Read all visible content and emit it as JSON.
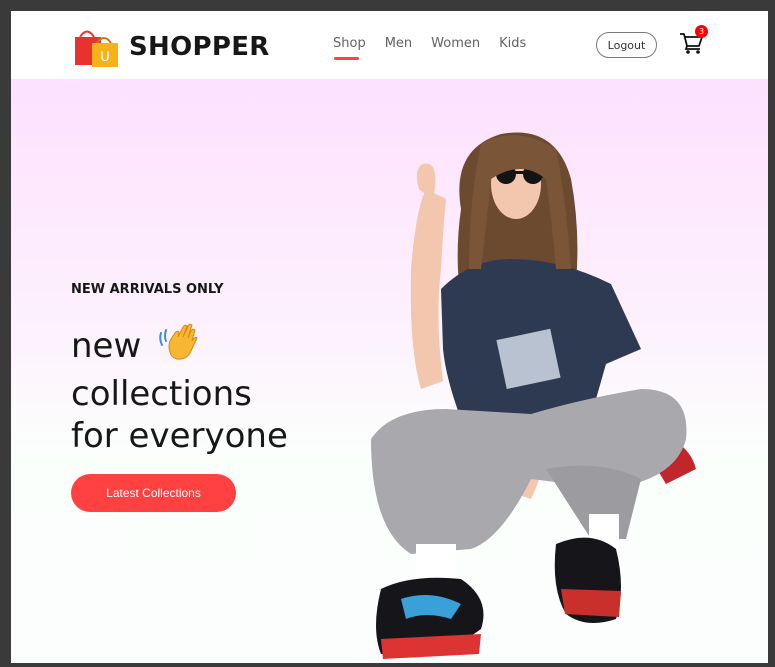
{
  "brand": {
    "name": "SHOPPER",
    "logo_letter": "U",
    "icon": "shopping-bag-logo"
  },
  "nav": {
    "items": [
      {
        "label": "Shop",
        "active": true
      },
      {
        "label": "Men",
        "active": false
      },
      {
        "label": "Women",
        "active": false
      },
      {
        "label": "Kids",
        "active": false
      }
    ],
    "logout_label": "Logout",
    "cart": {
      "icon": "cart-icon",
      "count": "3"
    }
  },
  "hero": {
    "eyebrow": "NEW ARRIVALS ONLY",
    "headline_line1": "new",
    "headline_line2": "collections",
    "headline_line3": "for everyone",
    "hand_icon": "waving-hand-icon",
    "cta_label": "Latest Collections",
    "hero_image": "model-in-sweatpants-and-sneakers"
  },
  "colors": {
    "accent": "#ff4141",
    "text": "#171717",
    "hero_gradient_top": "#fde1ff",
    "cart_badge": "#ff0000"
  }
}
